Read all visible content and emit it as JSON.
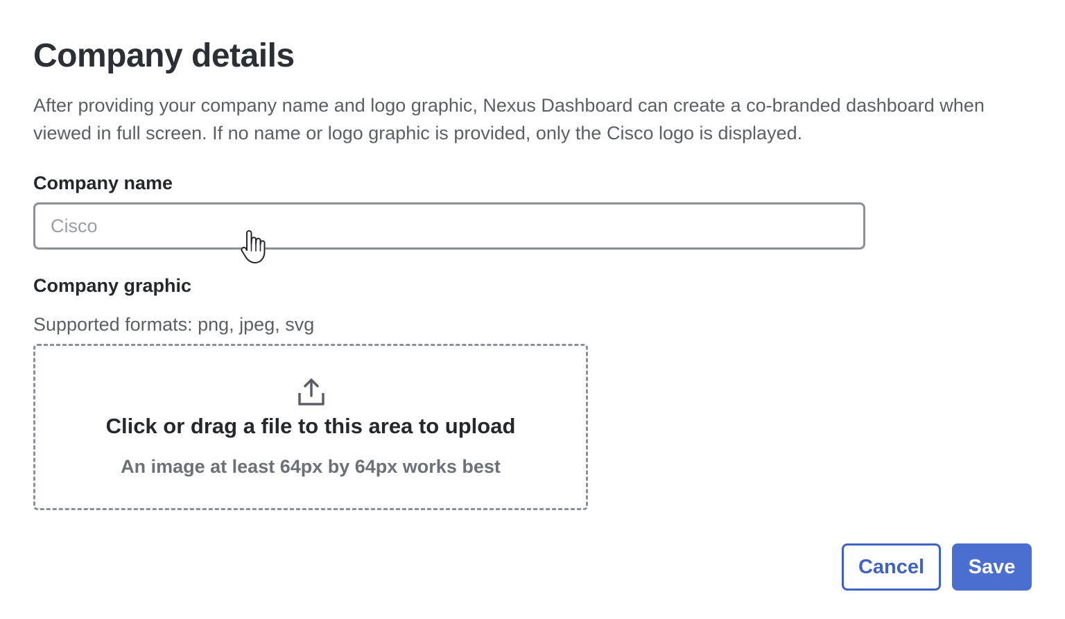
{
  "dialog": {
    "title": "Company details",
    "description": "After providing your company name and logo graphic, Nexus Dashboard can create a co-branded dashboard when viewed in full screen. If no name or logo graphic is provided, only the Cisco logo is displayed."
  },
  "company_name": {
    "label": "Company name",
    "placeholder": "Cisco",
    "value": ""
  },
  "company_graphic": {
    "label": "Company graphic",
    "formats": "Supported formats: png, jpeg, svg",
    "upload": {
      "icon": "upload-icon",
      "title": "Click or drag a file to this area to upload",
      "hint": "An image at least 64px by 64px works best"
    }
  },
  "actions": {
    "cancel_label": "Cancel",
    "save_label": "Save"
  },
  "colors": {
    "primary": "#4a6fd0",
    "primary_border": "#3f63c4",
    "input_border": "#8b8f96"
  }
}
